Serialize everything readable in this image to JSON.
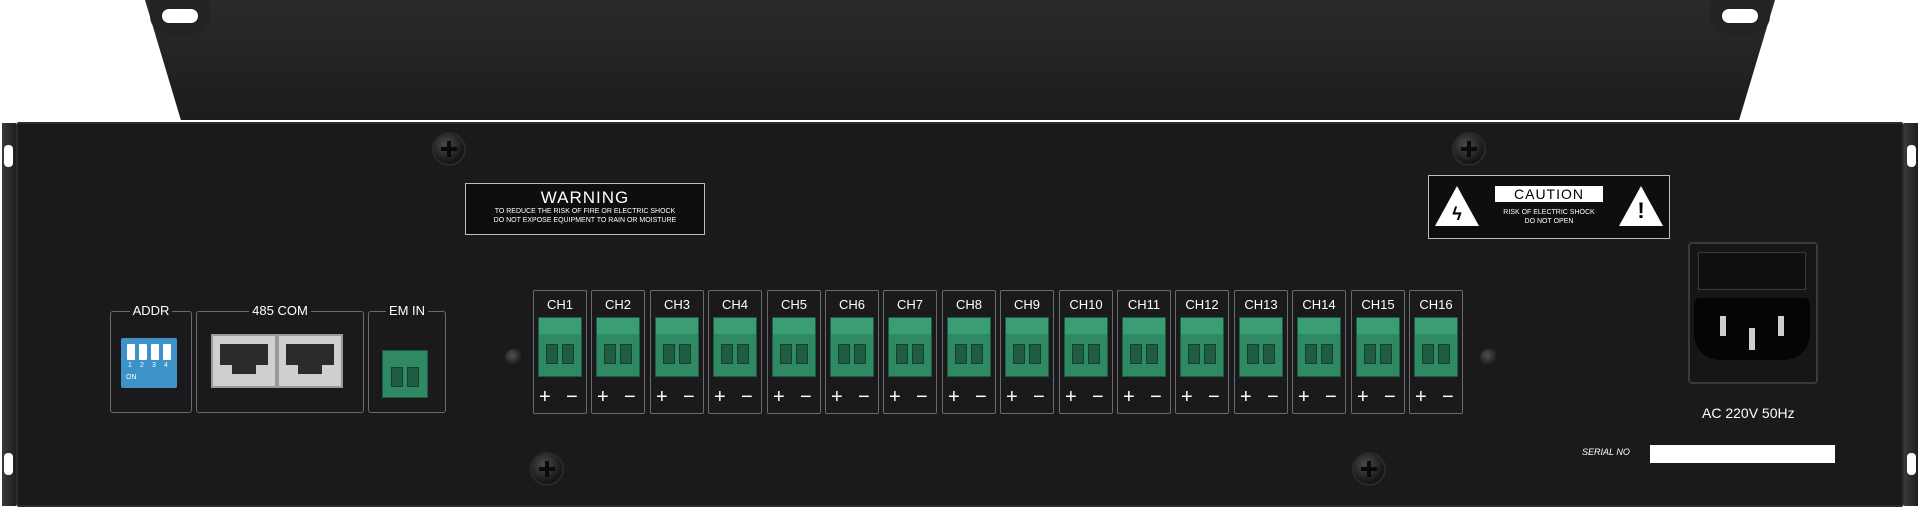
{
  "warning_label": {
    "title": "WARNING",
    "line1": "TO REDUCE THE RISK OF FIRE OR ELECTRIC SHOCK",
    "line2": "DO NOT EXPOSE EQUIPMENT TO RAIN OR MOISTURE"
  },
  "caution_label": {
    "title": "CAUTION",
    "line1": "RISK OF ELECTRIC SHOCK",
    "line2": "DO NOT OPEN"
  },
  "addr": {
    "label": "ADDR",
    "switch_numbers": [
      "1",
      "2",
      "3",
      "4"
    ],
    "on_text": "ON"
  },
  "com": {
    "label": "485 COM"
  },
  "em_in": {
    "label": "EM IN"
  },
  "channels": [
    "CH1",
    "CH2",
    "CH3",
    "CH4",
    "CH5",
    "CH6",
    "CH7",
    "CH8",
    "CH9",
    "CH10",
    "CH11",
    "CH12",
    "CH13",
    "CH14",
    "CH15",
    "CH16"
  ],
  "polarity": {
    "plus": "+",
    "minus": "−"
  },
  "power": {
    "label": "AC 220V 50Hz"
  },
  "serial": {
    "label": "SERIAL NO"
  },
  "colors": {
    "panel": "#1a1a1c",
    "terminal_green": "#2f8a64",
    "dip_blue": "#3d93c8",
    "rj45_gray": "#cfcfcf"
  }
}
